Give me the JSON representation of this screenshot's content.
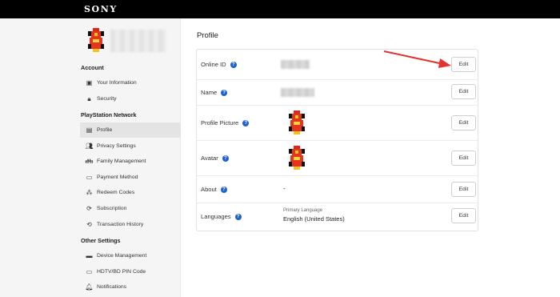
{
  "header": {
    "brand": "SONY"
  },
  "sidebar": {
    "sections": [
      {
        "title": "Account",
        "items": [
          {
            "label": "Your Information",
            "icon": "id-card-icon"
          },
          {
            "label": "Security",
            "icon": "lock-icon"
          }
        ]
      },
      {
        "title": "PlayStation Network",
        "items": [
          {
            "label": "Profile",
            "icon": "profile-icon",
            "active": true
          },
          {
            "label": "Privacy Settings",
            "icon": "privacy-icon"
          },
          {
            "label": "Family Management",
            "icon": "family-icon"
          },
          {
            "label": "Payment Method",
            "icon": "credit-card-icon"
          },
          {
            "label": "Redeem Codes",
            "icon": "redeem-icon"
          },
          {
            "label": "Subscription",
            "icon": "subscription-icon"
          },
          {
            "label": "Transaction History",
            "icon": "history-icon"
          }
        ]
      },
      {
        "title": "Other Settings",
        "items": [
          {
            "label": "Device Management",
            "icon": "console-icon"
          },
          {
            "label": "HDTV/BD PIN Code",
            "icon": "tv-icon"
          },
          {
            "label": "Notifications",
            "icon": "bell-icon"
          }
        ]
      }
    ]
  },
  "main": {
    "title": "Profile",
    "rows": [
      {
        "label": "Online ID",
        "value_type": "blurred",
        "edit": "Edit"
      },
      {
        "label": "Name",
        "value_type": "blurred",
        "edit": "Edit"
      },
      {
        "label": "Profile Picture",
        "value_type": "image",
        "edit": "Edit"
      },
      {
        "label": "Avatar",
        "value_type": "image",
        "edit": "Edit"
      },
      {
        "label": "About",
        "value": "-",
        "edit": "Edit"
      },
      {
        "label": "Languages",
        "sub": "Primary Language",
        "value": "English (United States)",
        "edit": "Edit"
      }
    ]
  },
  "colors": {
    "accent": "#1f62cf",
    "annotation_arrow": "#e5322f",
    "topbar": "#000000"
  }
}
